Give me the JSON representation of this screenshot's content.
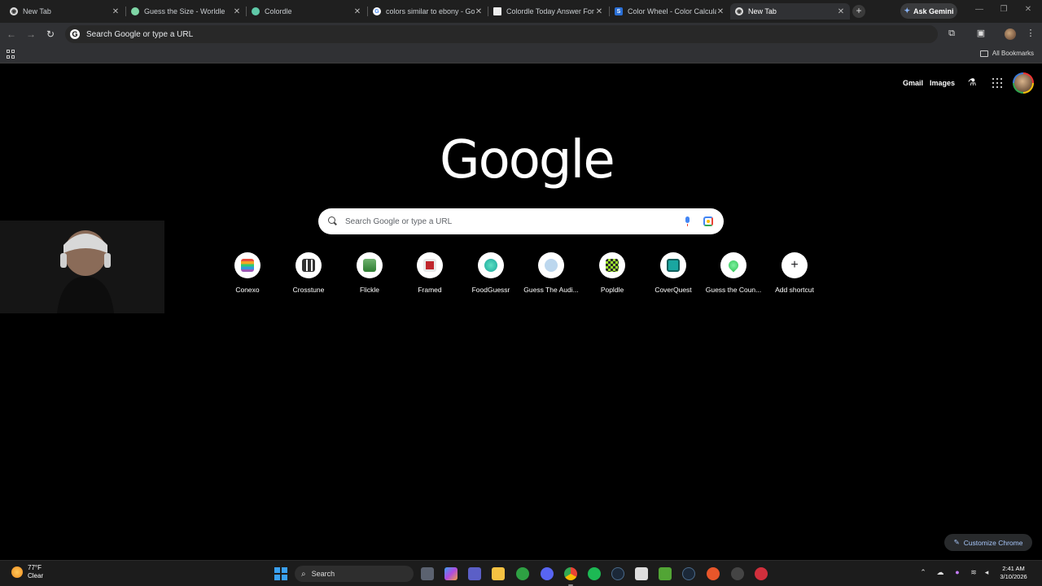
{
  "tabs": [
    {
      "title": "New Tab",
      "favicon": "chrome-icon",
      "active": false
    },
    {
      "title": "Guess the Size - Worldle",
      "favicon": "worldle-icon",
      "active": false
    },
    {
      "title": "Colordle",
      "favicon": "colordle-icon",
      "active": false
    },
    {
      "title": "colors similar to ebony - Goo",
      "favicon": "google-icon",
      "active": false
    },
    {
      "title": "Colordle Today Answer For I",
      "favicon": "page-icon",
      "active": false
    },
    {
      "title": "Color Wheel - Color Calculat",
      "favicon": "s-icon",
      "active": false
    },
    {
      "title": "New Tab",
      "favicon": "chrome-icon",
      "active": true
    }
  ],
  "gemini_label": "Ask Gemini",
  "omnibox": {
    "text": "Search Google or type a URL"
  },
  "bookmarks": {
    "all_label": "All Bookmarks"
  },
  "ntp": {
    "gmail": "Gmail",
    "images": "Images",
    "logo": "Google",
    "search_placeholder": "Search Google or type a URL",
    "shortcuts": [
      {
        "label": "Conexo",
        "icon": "conexo-icon",
        "color": "#e84d3d"
      },
      {
        "label": "Crosstune",
        "icon": "crosstune-icon",
        "color": "#333333"
      },
      {
        "label": "Flickle",
        "icon": "flickle-icon",
        "color": "#2f7d32"
      },
      {
        "label": "Framed",
        "icon": "framed-icon",
        "color": "#c0262c"
      },
      {
        "label": "FoodGuessr",
        "icon": "foodguessr-icon",
        "color": "#17a79a"
      },
      {
        "label": "Guess The Audi...",
        "icon": "audio-icon",
        "color": "#bcd7ee"
      },
      {
        "label": "Popldle",
        "icon": "popldle-icon",
        "color": "#9be22d"
      },
      {
        "label": "CoverQuest",
        "icon": "coverquest-icon",
        "color": "#1aa6a0"
      },
      {
        "label": "Guess the Coun...",
        "icon": "globe-pin-icon",
        "color": "#34c759"
      },
      {
        "label": "Add shortcut",
        "icon": "plus-icon",
        "color": "#202124"
      }
    ],
    "customize_label": "Customize Chrome"
  },
  "taskbar": {
    "weather_temp": "77°F",
    "weather_cond": "Clear",
    "search_label": "Search",
    "time": "2:41 AM",
    "date": "3/10/2026"
  }
}
